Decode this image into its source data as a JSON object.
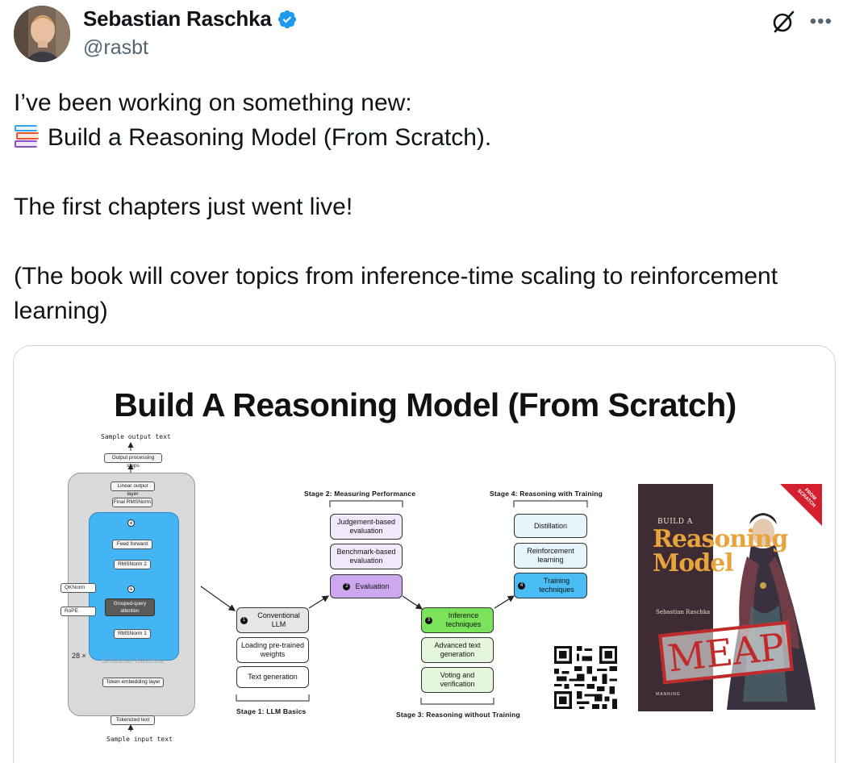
{
  "author": {
    "display_name": "Sebastian Raschka",
    "handle": "@rasbt",
    "verified": true
  },
  "colors": {
    "verified_badge": "#1d9bf0",
    "text_primary": "#0f1419",
    "text_secondary": "#536471",
    "border": "#cfd9de"
  },
  "icons": {
    "verified": "verified-badge-icon",
    "grok": "grok-icon",
    "more": "more-options-icon",
    "books": "books-emoji"
  },
  "header": {
    "more_label": "•••"
  },
  "tweet": {
    "line1": "I’ve been working on something new:",
    "line2": "Build a Reasoning Model (From Scratch).",
    "line3": "The first chapters just went live!",
    "line4": "(The book will cover topics from inference-time scaling to reinforcement learning)"
  },
  "figure": {
    "title": "Build A Reasoning Model (From Scratch)",
    "architecture": {
      "sample_output": "Sample output text",
      "output_processing": "Output processing steps",
      "linear_output": "Linear output layer",
      "final_norm": "Final RMSNorm",
      "feed_forward": "Feed forward",
      "rmsnorm2": "RMSNorm 2",
      "gqa_line1": "Grouped-query",
      "gqa_line2": "attention",
      "rmsnorm1": "RMSNorm 1",
      "qknorm": "QKNorm",
      "rope": "RoPE",
      "repeat": "28 ×",
      "watermark": "Sebastian Raschka",
      "token_embedding": "Token embedding layer",
      "tokenized_text": "Tokenized text",
      "sample_input": "Sample input text"
    },
    "stages": {
      "stage1_label": "Stage 1: LLM Basics",
      "stage2_label": "Stage 2: Measuring Performance",
      "stage3_label": "Stage 3: Reasoning without Training",
      "stage4_label": "Stage 4: Reasoning with Training",
      "s1_main": "Conventional LLM",
      "s1_a": "Loading pre-trained weights",
      "s1_b": "Text generation",
      "s2_a": "Judgement-based evaluation",
      "s2_b": "Benchmark-based evaluation",
      "s2_main": "Evaluation",
      "s3_main": "Inference techniques",
      "s3_a": "Advanced text generation",
      "s3_b": "Voting and verification",
      "s4_a": "Distillation",
      "s4_b": "Reinforcement learning",
      "s4_main": "Training techniques",
      "n1": "1",
      "n2": "2",
      "n3": "3",
      "n4": "4"
    },
    "book": {
      "build": "BUILD A",
      "title_line1": "Reasoning",
      "title_line2": "Model",
      "author": "Sebastian Raschka",
      "publisher": "MANNING",
      "stamp": "MEAP",
      "corner_line1": "FROM",
      "corner_line2": "SCRATCH"
    }
  }
}
